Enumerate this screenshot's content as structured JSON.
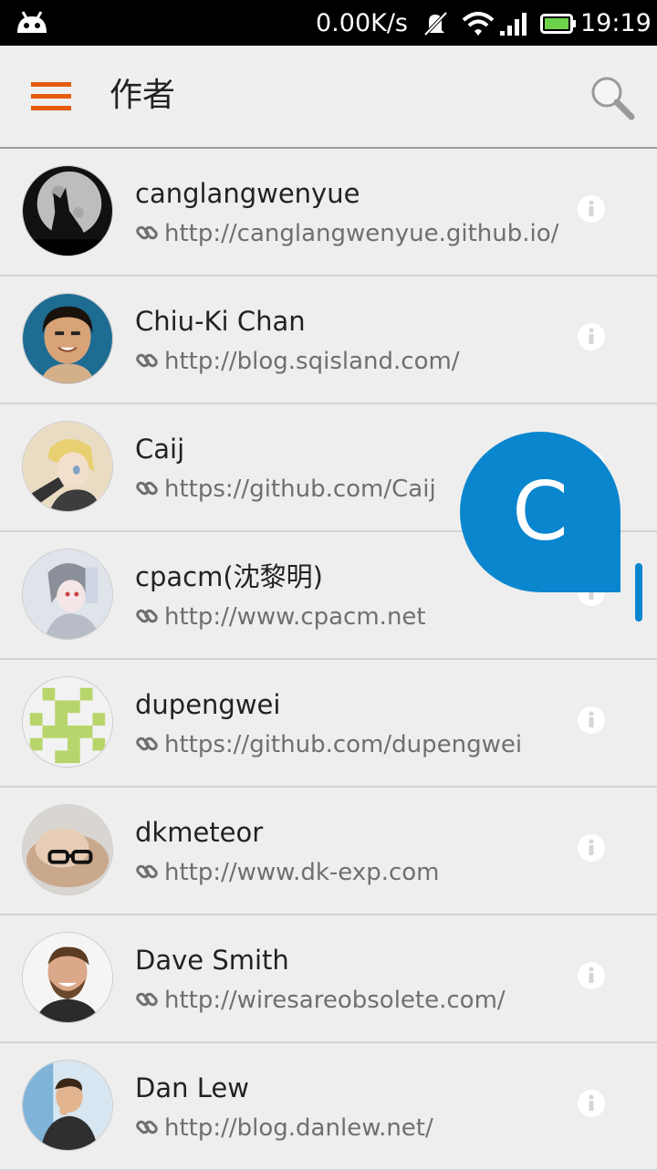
{
  "status_bar": {
    "net_speed": "0.00K/s",
    "time": "19:19"
  },
  "app_bar": {
    "title": "作者"
  },
  "authors": [
    {
      "name": "canglangwenyue",
      "url": "http://canglangwenyue.github.io/"
    },
    {
      "name": "Chiu-Ki Chan",
      "url": "http://blog.sqisland.com/"
    },
    {
      "name": "Caij",
      "url": "https://github.com/Caij"
    },
    {
      "name": "cpacm(沈黎明)",
      "url": "http://www.cpacm.net"
    },
    {
      "name": "dupengwei",
      "url": "https://github.com/dupengwei"
    },
    {
      "name": "dkmeteor",
      "url": "http://www.dk-exp.com"
    },
    {
      "name": "Dave Smith",
      "url": "http://wiresareobsolete.com/"
    },
    {
      "name": "Dan Lew",
      "url": "http://blog.danlew.net/"
    }
  ],
  "index_bubble": {
    "letter": "C"
  },
  "colors": {
    "accent": "#e65b0c",
    "bubble": "#0a86cf",
    "background": "#eeeeee"
  }
}
